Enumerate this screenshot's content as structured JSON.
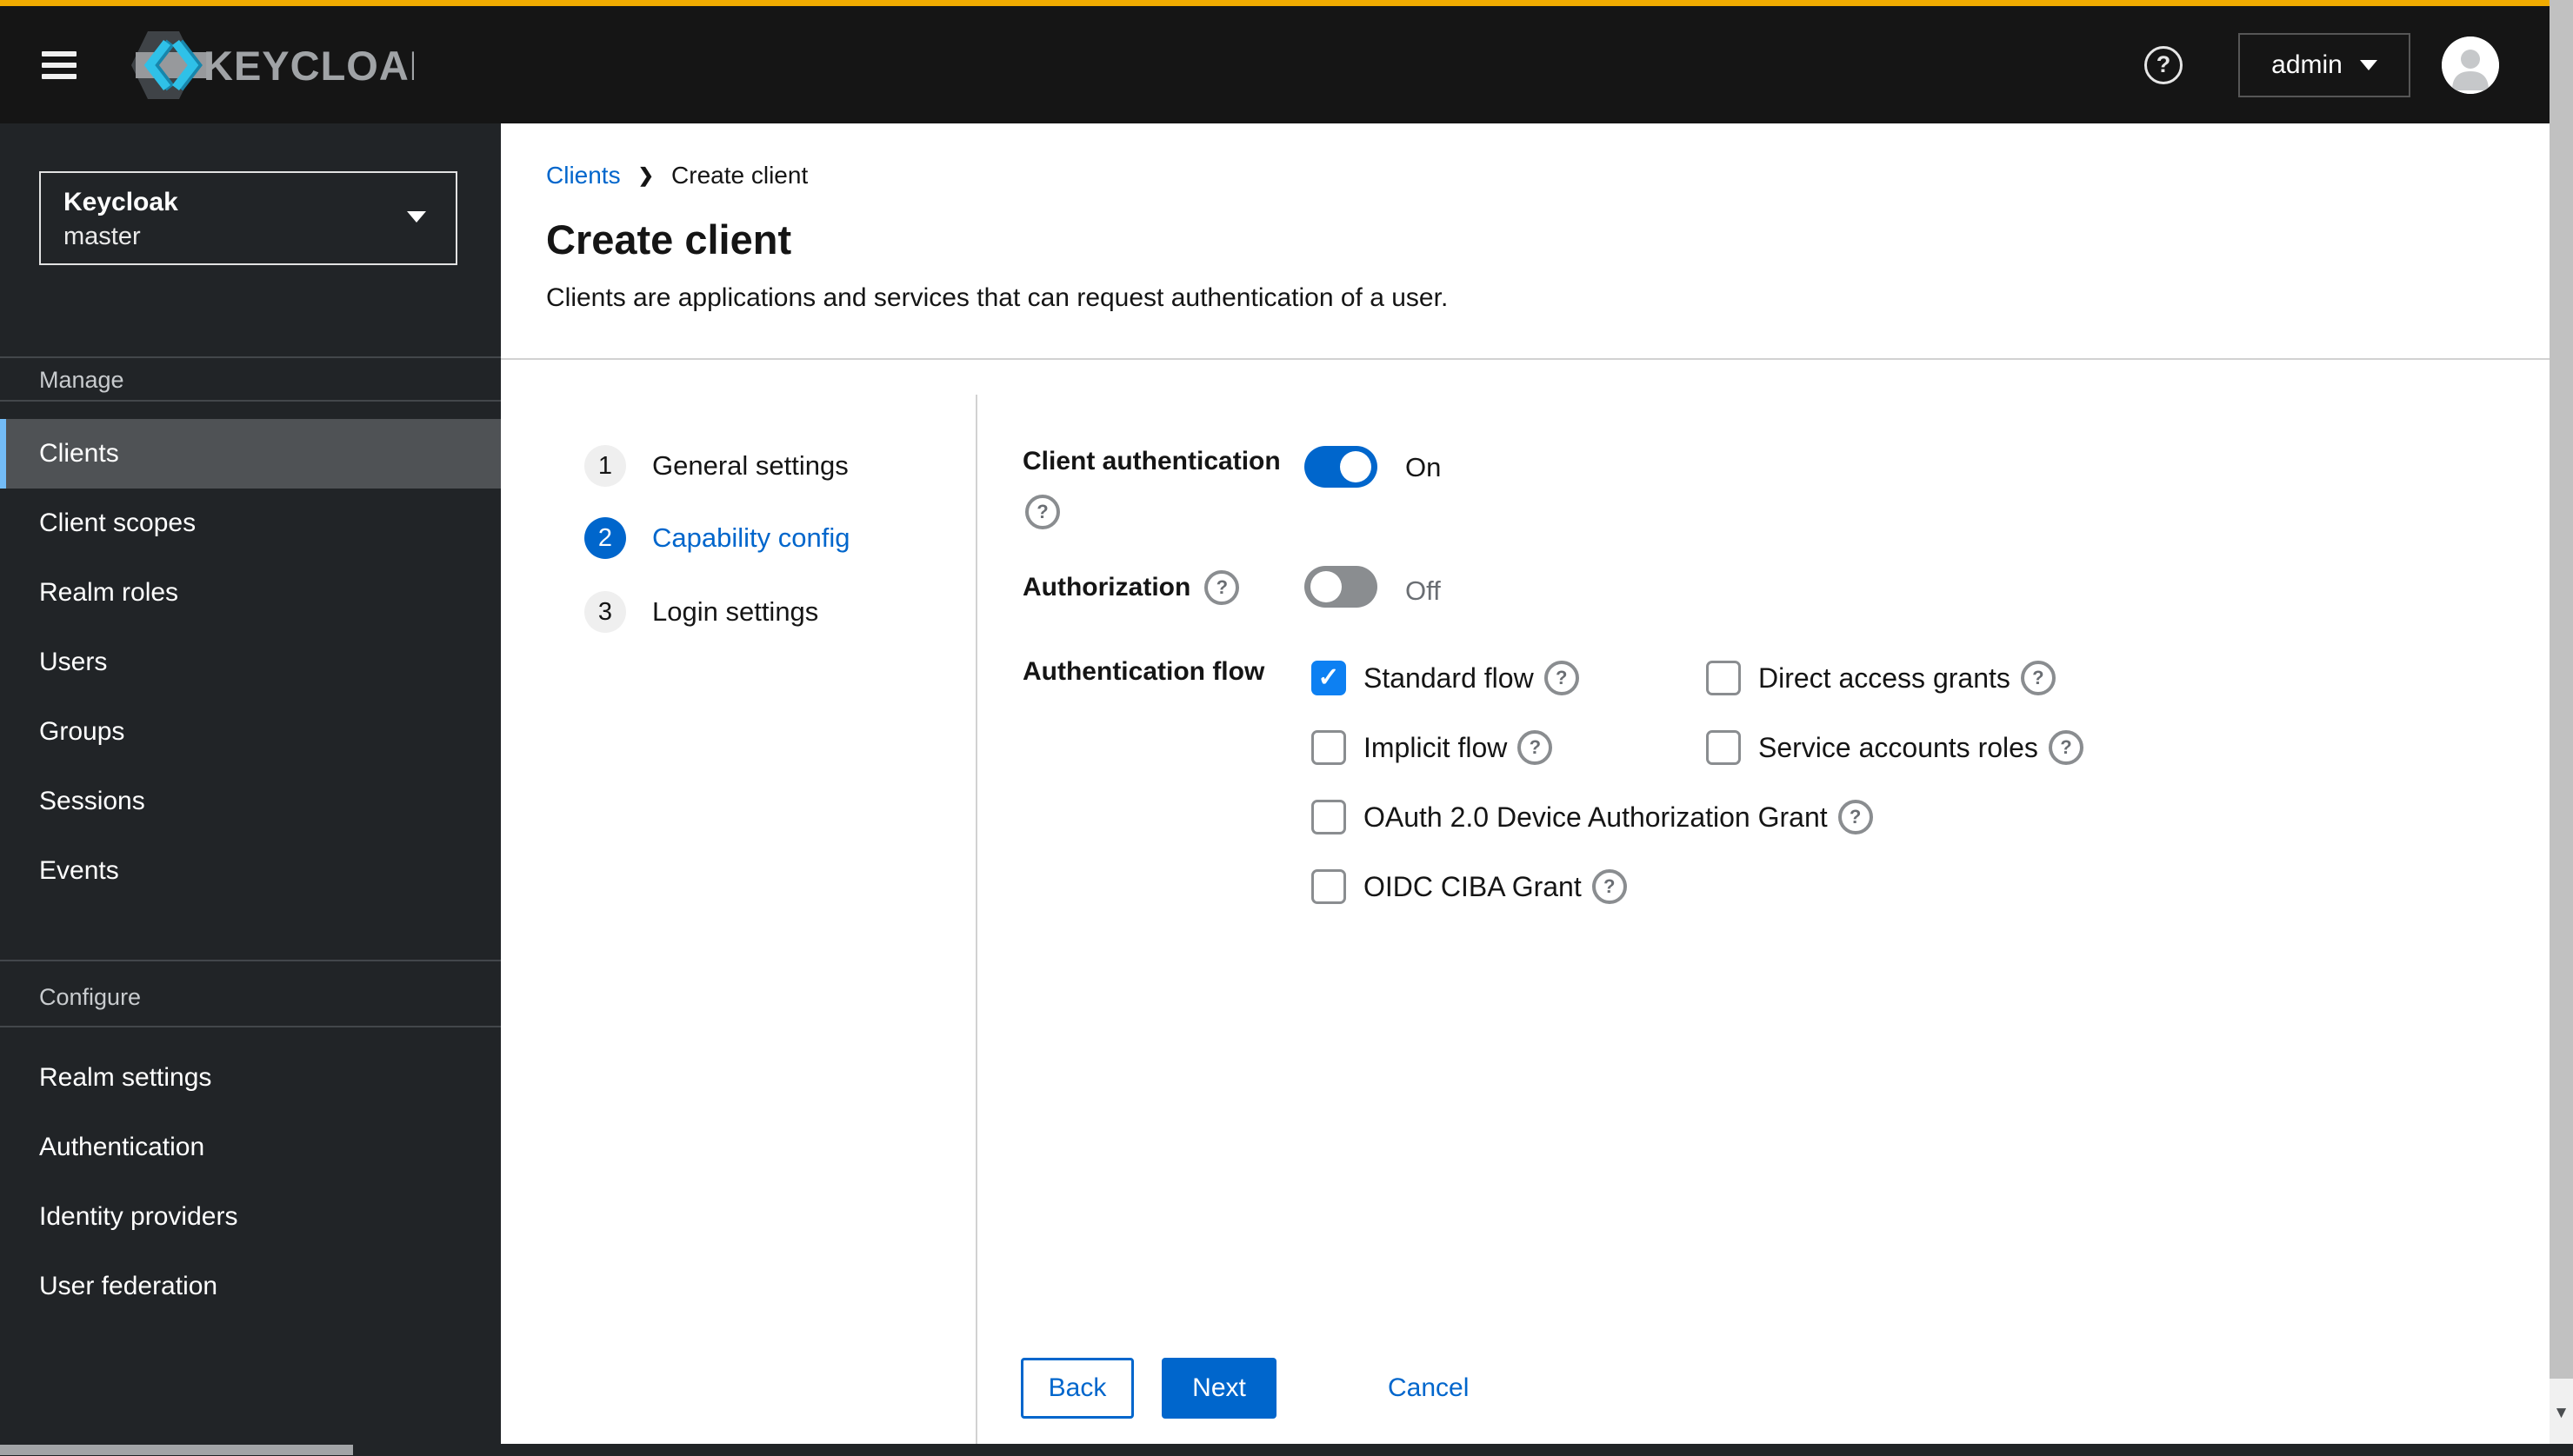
{
  "colors": {
    "accent": "#f0ab00",
    "primary": "#0066cc",
    "masthead_bg": "#151515",
    "sidebar_bg": "#212427",
    "nav_selected_bg": "#4f5255",
    "nav_selected_border": "#73bcf7",
    "checkbox_checked": "#0d80f2"
  },
  "icons": {
    "help": "?",
    "check": "✓",
    "breadcrumb_chevron": "❯",
    "scroll_arrow_down": "▼"
  },
  "masthead": {
    "brand": "KEYCLOAK",
    "user": "admin"
  },
  "sidebar": {
    "realm_selector": {
      "title": "Keycloak",
      "realm": "master"
    },
    "sections": [
      {
        "label": "Manage",
        "items": [
          {
            "label": "Clients",
            "active": true
          },
          {
            "label": "Client scopes",
            "active": false
          },
          {
            "label": "Realm roles",
            "active": false
          },
          {
            "label": "Users",
            "active": false
          },
          {
            "label": "Groups",
            "active": false
          },
          {
            "label": "Sessions",
            "active": false
          },
          {
            "label": "Events",
            "active": false
          }
        ]
      },
      {
        "label": "Configure",
        "items": [
          {
            "label": "Realm settings",
            "active": false
          },
          {
            "label": "Authentication",
            "active": false
          },
          {
            "label": "Identity providers",
            "active": false
          },
          {
            "label": "User federation",
            "active": false
          }
        ]
      }
    ]
  },
  "breadcrumb": {
    "items": [
      {
        "label": "Clients",
        "link": true
      },
      {
        "label": "Create client",
        "link": false
      }
    ]
  },
  "page_header": {
    "title": "Create client",
    "description": "Clients are applications and services that can request authentication of a user."
  },
  "wizard": {
    "steps": [
      {
        "number": "1",
        "label": "General settings",
        "active": false
      },
      {
        "number": "2",
        "label": "Capability config",
        "active": true
      },
      {
        "number": "3",
        "label": "Login settings",
        "active": false
      }
    ]
  },
  "form": {
    "client_authentication": {
      "label": "Client authentication",
      "value": "On",
      "on": true
    },
    "authorization": {
      "label": "Authorization",
      "value": "Off",
      "on": false
    },
    "authentication_flow": {
      "label": "Authentication flow",
      "options": [
        {
          "label": "Standard flow",
          "checked": true
        },
        {
          "label": "Direct access grants",
          "checked": false
        },
        {
          "label": "Implicit flow",
          "checked": false
        },
        {
          "label": "Service accounts roles",
          "checked": false
        },
        {
          "label": "OAuth 2.0 Device Authorization Grant",
          "checked": false
        },
        {
          "label": "OIDC CIBA Grant",
          "checked": false
        }
      ]
    }
  },
  "footer": {
    "back": "Back",
    "next": "Next",
    "cancel": "Cancel"
  }
}
